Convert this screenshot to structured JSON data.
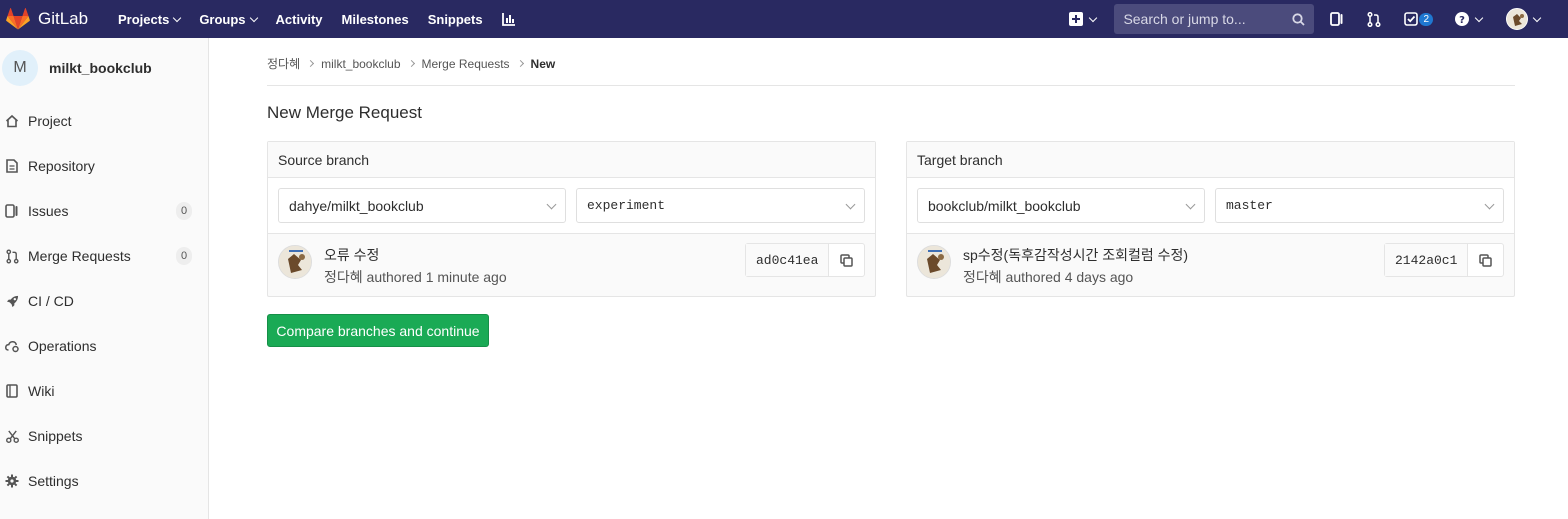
{
  "navbar": {
    "brand": "GitLab",
    "links": [
      {
        "label": "Projects",
        "dropdown": true
      },
      {
        "label": "Groups",
        "dropdown": true
      },
      {
        "label": "Activity",
        "dropdown": false
      },
      {
        "label": "Milestones",
        "dropdown": false
      },
      {
        "label": "Snippets",
        "dropdown": false
      }
    ],
    "search_placeholder": "Search or jump to...",
    "todos_count": "2"
  },
  "sidebar": {
    "avatar_letter": "M",
    "project_name": "milkt_bookclub",
    "items": [
      {
        "label": "Project",
        "icon": "home-icon"
      },
      {
        "label": "Repository",
        "icon": "doc-icon"
      },
      {
        "label": "Issues",
        "icon": "issues-icon",
        "count": "0"
      },
      {
        "label": "Merge Requests",
        "icon": "merge-request-icon",
        "count": "0"
      },
      {
        "label": "CI / CD",
        "icon": "rocket-icon"
      },
      {
        "label": "Operations",
        "icon": "cloud-gear-icon"
      },
      {
        "label": "Wiki",
        "icon": "book-icon"
      },
      {
        "label": "Snippets",
        "icon": "scissors-icon"
      },
      {
        "label": "Settings",
        "icon": "gear-icon"
      }
    ]
  },
  "breadcrumb": [
    "정다혜",
    "milkt_bookclub",
    "Merge Requests",
    "New"
  ],
  "page_title": "New Merge Request",
  "source": {
    "heading": "Source branch",
    "project": "dahye/milkt_bookclub",
    "branch": "experiment",
    "commit_title": "오류 수정",
    "commit_author": "정다혜",
    "commit_meta": "authored 1 minute ago",
    "sha": "ad0c41ea"
  },
  "target": {
    "heading": "Target branch",
    "project": "bookclub/milkt_bookclub",
    "branch": "master",
    "commit_title": "sp수정(독후감작성시간 조회컬럼 수정)",
    "commit_author": "정다혜",
    "commit_meta": "authored 4 days ago",
    "sha": "2142a0c1"
  },
  "compare_button": "Compare branches and continue",
  "colors": {
    "navbar": "#292961",
    "success": "#1aaa55",
    "badge": "#1f78d1"
  }
}
